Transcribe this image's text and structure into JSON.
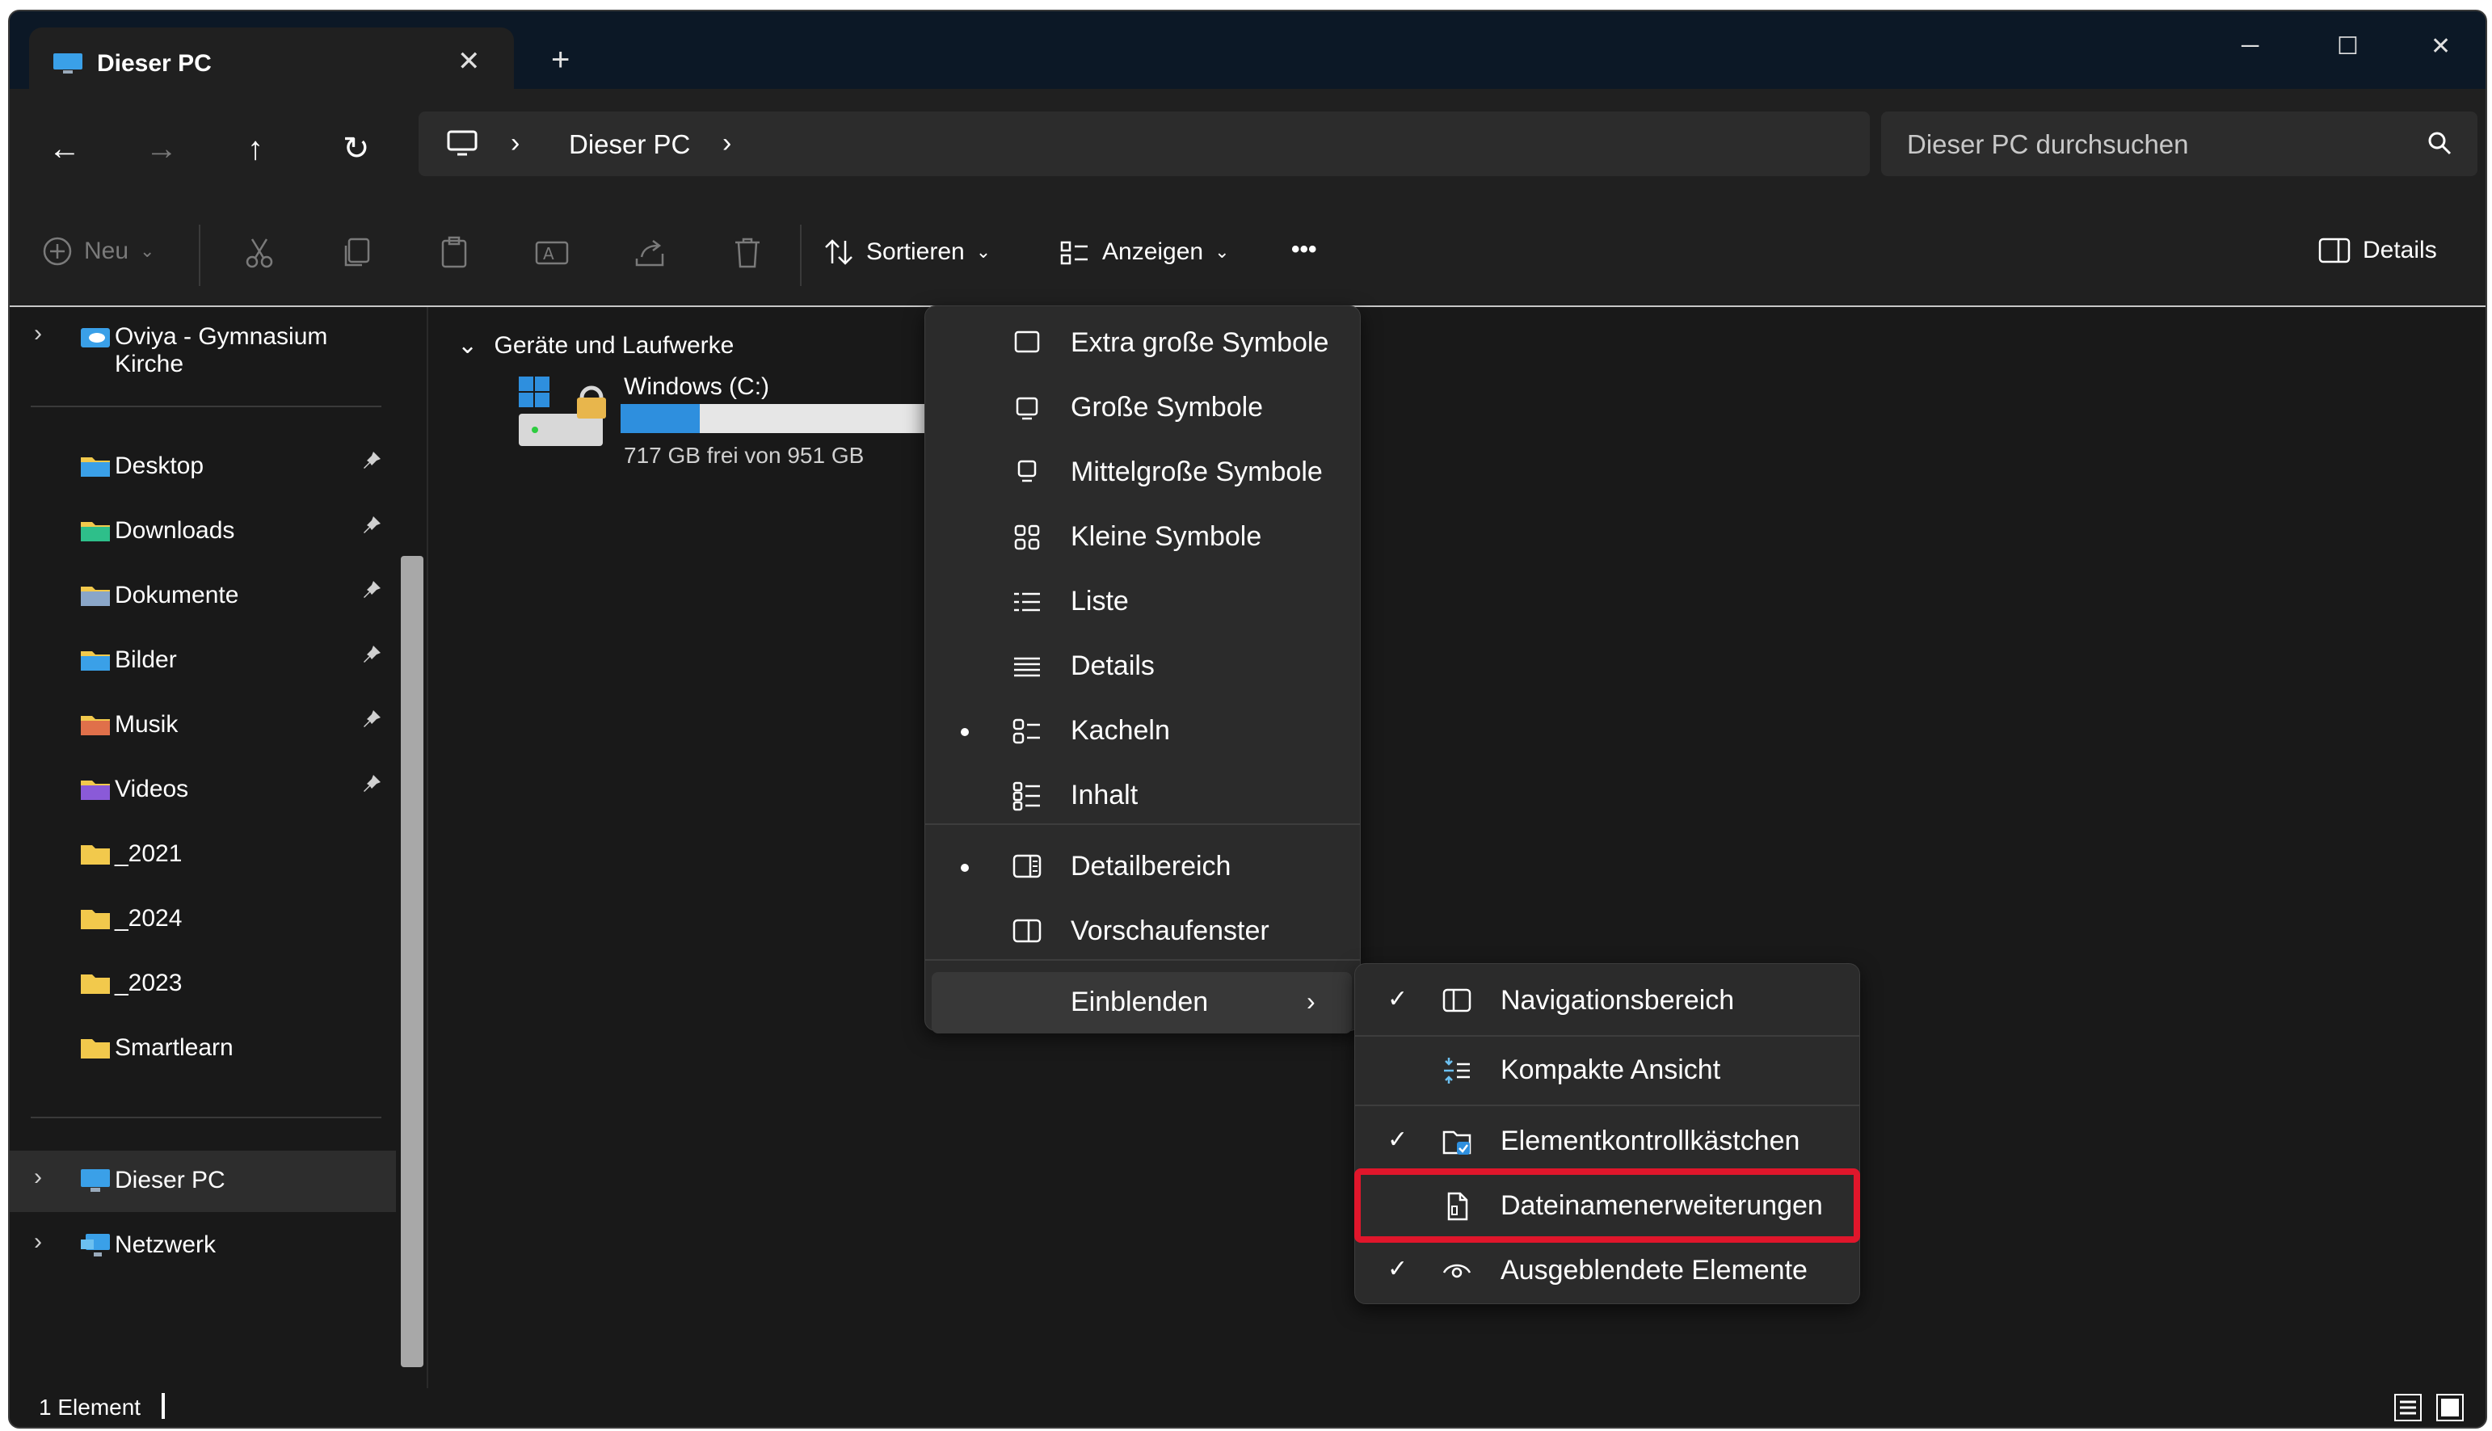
{
  "window": {
    "tab_title": "Dieser PC",
    "close_tab": "✕",
    "new_tab": "+",
    "minimize": "─",
    "maximize": "☐",
    "close": "✕"
  },
  "nav": {
    "back": "←",
    "forward": "→",
    "up": "↑",
    "refresh": "↻"
  },
  "address": {
    "crumb": "Dieser PC",
    "separator": "›"
  },
  "search": {
    "placeholder": "Dieser PC durchsuchen"
  },
  "toolbar": {
    "new_label": "Neu",
    "sort_label": "Sortieren",
    "view_label": "Anzeigen",
    "more_label": "•••",
    "details_label": "Details"
  },
  "sidebar": {
    "onedrive": "Oviya - Gymnasium Kirche",
    "quick_access": [
      {
        "label": "Desktop",
        "icon": "desktop-folder-icon",
        "pinned": true
      },
      {
        "label": "Downloads",
        "icon": "downloads-folder-icon",
        "pinned": true
      },
      {
        "label": "Dokumente",
        "icon": "documents-folder-icon",
        "pinned": true
      },
      {
        "label": "Bilder",
        "icon": "pictures-folder-icon",
        "pinned": true
      },
      {
        "label": "Musik",
        "icon": "music-folder-icon",
        "pinned": true
      },
      {
        "label": "Videos",
        "icon": "videos-folder-icon",
        "pinned": true
      },
      {
        "label": "_2021",
        "icon": "folder-icon",
        "pinned": false
      },
      {
        "label": "_2024",
        "icon": "folder-icon",
        "pinned": false
      },
      {
        "label": "_2023",
        "icon": "folder-icon",
        "pinned": false
      },
      {
        "label": "Smartlearn",
        "icon": "folder-icon",
        "pinned": false
      }
    ],
    "this_pc": "Dieser PC",
    "network": "Netzwerk",
    "pin_glyph": "📌",
    "expand_glyph": "›"
  },
  "content": {
    "group_header": "Geräte und Laufwerke",
    "group_chevron": "⌄",
    "drive": {
      "name": "Windows (C:)",
      "free_text": "717 GB frei von 951 GB",
      "used_fraction": 0.246
    }
  },
  "view_menu": {
    "items": [
      {
        "label": "Extra große Symbole",
        "selected": false
      },
      {
        "label": "Große Symbole",
        "selected": false
      },
      {
        "label": "Mittelgroße Symbole",
        "selected": false
      },
      {
        "label": "Kleine Symbole",
        "selected": false
      },
      {
        "label": "Liste",
        "selected": false
      },
      {
        "label": "Details",
        "selected": false
      },
      {
        "label": "Kacheln",
        "selected": true
      },
      {
        "label": "Inhalt",
        "selected": false
      },
      {
        "label": "Detailbereich",
        "selected": true
      },
      {
        "label": "Vorschaufenster",
        "selected": false
      },
      {
        "label": "Einblenden",
        "submenu": true
      }
    ]
  },
  "show_menu": {
    "items": [
      {
        "label": "Navigationsbereich",
        "checked": true
      },
      {
        "label": "Kompakte Ansicht",
        "checked": false
      },
      {
        "label": "Elementkontrollkästchen",
        "checked": true
      },
      {
        "label": "Dateinamenerweiterungen",
        "checked": false
      },
      {
        "label": "Ausgeblendete Elemente",
        "checked": true
      }
    ],
    "check_glyph": "✓",
    "highlight_color": "#e0162b"
  },
  "status": {
    "count": "1 Element"
  },
  "colors": {
    "accent": "#2e8fde",
    "background": "#191919",
    "menu": "#2b2b2b"
  }
}
